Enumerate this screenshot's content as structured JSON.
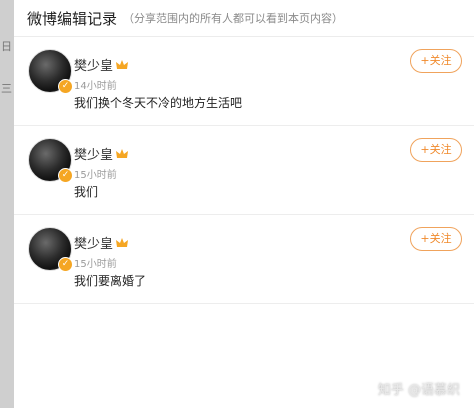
{
  "header": {
    "title": "微博编辑记录",
    "subtitle": "（分享范围内的所有人都可以看到本页内容）"
  },
  "entries": [
    {
      "name": "樊少皇",
      "time": "14小时前",
      "text": "我们换个冬天不冷的地方生活吧",
      "follow_label": "+关注"
    },
    {
      "name": "樊少皇",
      "time": "15小时前",
      "text": "我们",
      "follow_label": "+关注"
    },
    {
      "name": "樊少皇",
      "time": "15小时前",
      "text": "我们要离婚了",
      "follow_label": "+关注"
    }
  ],
  "watermark": "知乎 @语慕织",
  "left_fragments": [
    "日",
    "三"
  ],
  "colors": {
    "accent": "#f08a2c",
    "verified": "#f5a623"
  }
}
